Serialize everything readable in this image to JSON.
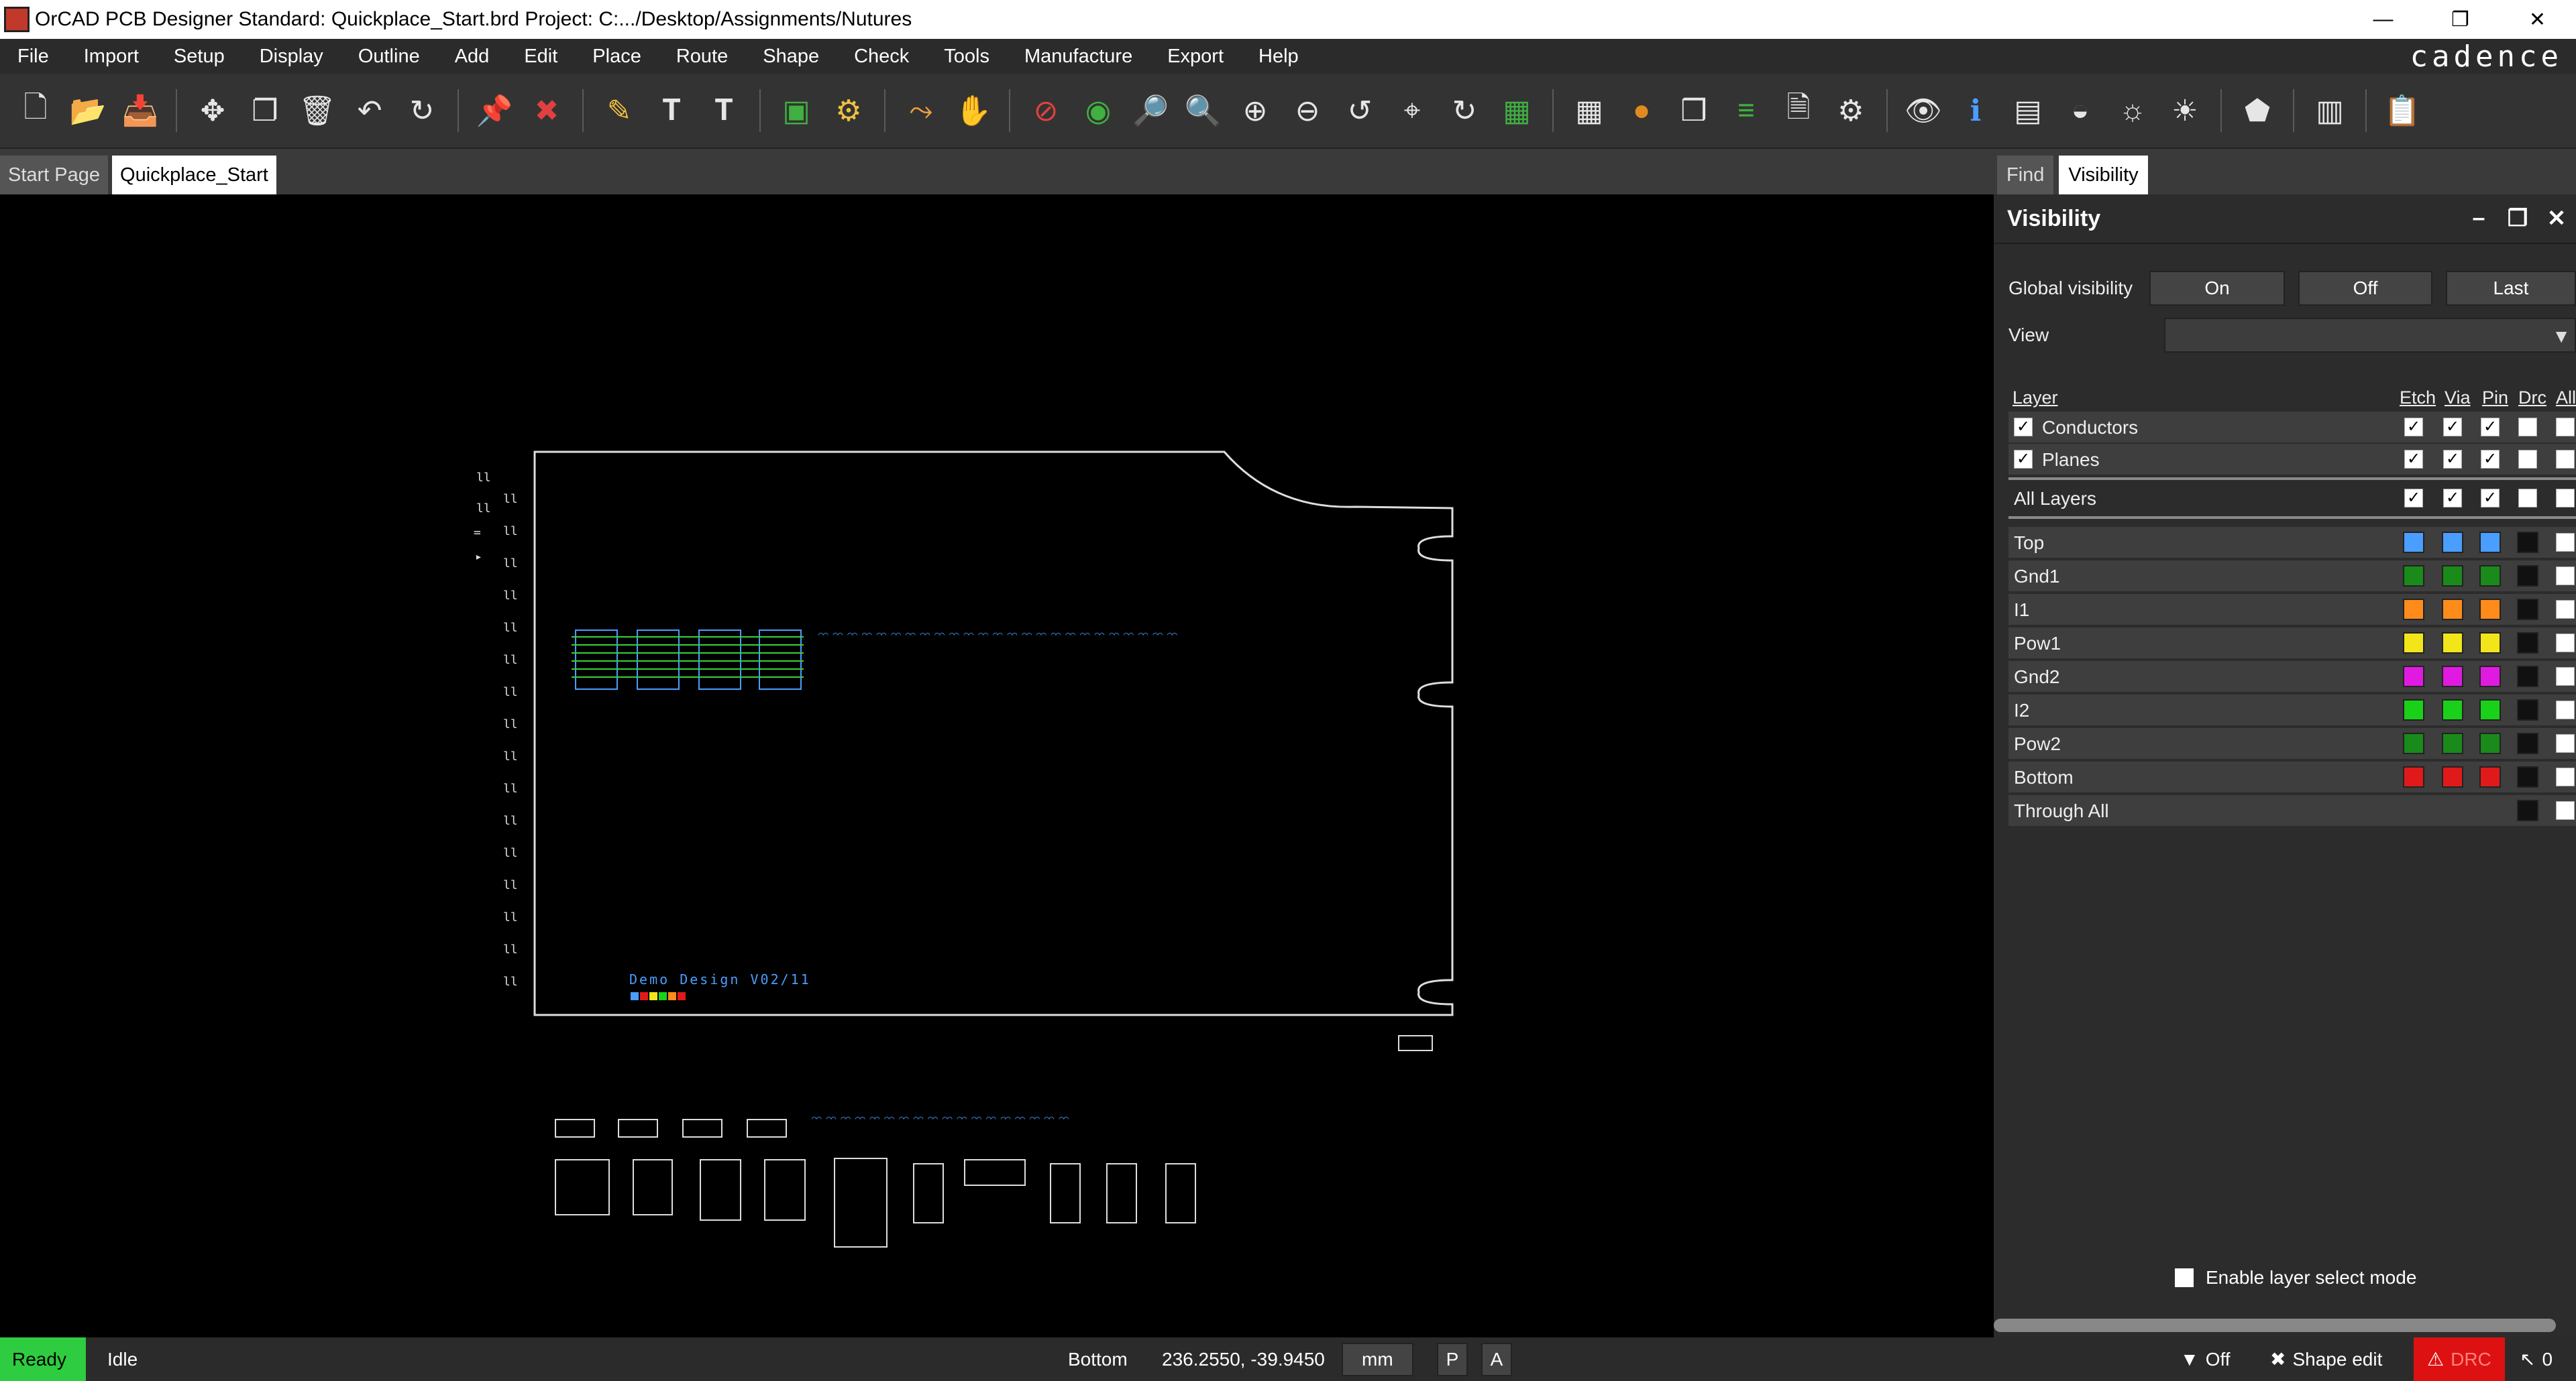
{
  "window": {
    "title": "OrCAD PCB Designer Standard: Quickplace_Start.brd  Project: C:.../Desktop/Assignments/Nutures",
    "controls": [
      "—",
      "❐",
      "✕"
    ]
  },
  "menu": {
    "items": [
      "File",
      "Import",
      "Setup",
      "Display",
      "Outline",
      "Add",
      "Edit",
      "Place",
      "Route",
      "Shape",
      "Check",
      "Tools",
      "Manufacture",
      "Export",
      "Help"
    ],
    "brand": "cadence"
  },
  "toolbar": {
    "groups": [
      [
        "new-file-icon",
        "open-folder-icon",
        "save-icon"
      ],
      [
        "move-icon",
        "copy-icon",
        "delete-icon",
        "undo-icon",
        "redo-icon"
      ],
      [
        "pin-icon",
        "unfix-icon"
      ],
      [
        "add-line-icon",
        "add-text-icon",
        "edit-text-icon"
      ],
      [
        "place-component-icon",
        "place-manual-icon"
      ],
      [
        "add-connect-icon",
        "slide-icon"
      ],
      [
        "unroute-icon",
        "shape-add-icon",
        "zoom-fit-icon",
        "zoom-window-icon",
        "zoom-in-icon",
        "zoom-out-icon",
        "zoom-previous-icon",
        "zoom-center-icon",
        "refresh-icon",
        "3d-view-icon"
      ],
      [
        "grid-icon",
        "color-icon",
        "layer-icon",
        "stack-icon",
        "report-icon",
        "settings-icon"
      ],
      [
        "visibility-icon",
        "info-icon",
        "database-icon",
        "shadow-icon",
        "light-icon",
        "bright-icon"
      ],
      [
        "shape-icon"
      ],
      [
        "layout-icon"
      ],
      [
        "clipboard-icon"
      ]
    ]
  },
  "tabs": {
    "documents": [
      "Start Page",
      "Quickplace_Start"
    ],
    "active_document": "Quickplace_Start",
    "panels": [
      "Find",
      "Visibility"
    ],
    "active_panel": "Visibility"
  },
  "canvas": {
    "board_label": "Demo Design V02/11"
  },
  "visibility": {
    "title": "Visibility",
    "global_label": "Global visibility",
    "buttons": [
      "On",
      "Off",
      "Last"
    ],
    "view_label": "View",
    "view_value": "",
    "headers": {
      "layer": "Layer",
      "etch": "Etch",
      "via": "Via",
      "pin": "Pin",
      "drc": "Drc",
      "all": "All"
    },
    "groups": [
      {
        "name": "Conductors",
        "checked": true
      },
      {
        "name": "Planes",
        "checked": true
      }
    ],
    "all_layers": "All Layers",
    "layers": [
      {
        "name": "Top",
        "color": "#4a9eff"
      },
      {
        "name": "Gnd1",
        "color": "#1a8a1a"
      },
      {
        "name": "I1",
        "color": "#ff8c1a"
      },
      {
        "name": "Pow1",
        "color": "#f2e51a"
      },
      {
        "name": "Gnd2",
        "color": "#e01ae0"
      },
      {
        "name": "I2",
        "color": "#1ad11a"
      },
      {
        "name": "Pow2",
        "color": "#1a8a1a"
      },
      {
        "name": "Bottom",
        "color": "#e01a1a"
      },
      {
        "name": "Through All",
        "color": ""
      }
    ],
    "enable_layer_select": "Enable layer select mode"
  },
  "status": {
    "ready": "Ready",
    "state": "Idle",
    "layer": "Bottom",
    "coords": "236.2550, -39.9450",
    "units": "mm",
    "p_button": "P",
    "a_button": "A",
    "filter": "Off",
    "mode": "Shape edit",
    "drc": "DRC",
    "pick_count": "0"
  }
}
